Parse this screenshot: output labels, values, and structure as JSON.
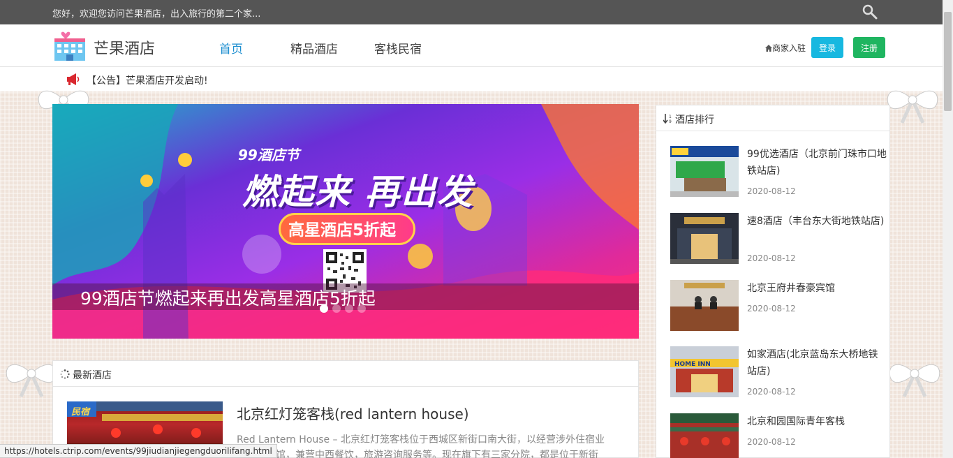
{
  "topbar": {
    "welcome": "您好，欢迎您访问芒果酒店，出入旅行的第二个家..."
  },
  "header": {
    "logo_text": "芒果酒店",
    "nav": [
      "首页",
      "精品酒店",
      "客栈民宿"
    ],
    "merchant": "商家入驻",
    "login": "登录",
    "register": "注册"
  },
  "notice": {
    "text": "【公告】芒果酒店开发启动!"
  },
  "banner": {
    "caption": "99酒店节燃起来再出发高星酒店5折起",
    "slogan_small": "99酒店节",
    "slogan_big": "燃起来 再出发",
    "pill": "高星酒店5折起",
    "active_slide": 1,
    "slide_count": 4
  },
  "ranking": {
    "title": "酒店排行",
    "items": [
      {
        "name": "99优选酒店（北京前门珠市口地铁站店)",
        "date": "2020-08-12"
      },
      {
        "name": "速8酒店（丰台东大街地铁站店)",
        "date": "2020-08-12"
      },
      {
        "name": "北京王府井春豪宾馆",
        "date": "2020-08-12"
      },
      {
        "name": "如家酒店(北京蓝岛东大桥地铁站店)",
        "date": "2020-08-12"
      },
      {
        "name": "北京和园国际青年客栈",
        "date": "2020-08-12"
      }
    ]
  },
  "latest": {
    "title": "最新酒店",
    "hotel_name": "北京红灯笼客栈(red lantern house)",
    "badge": "民宿",
    "desc": "Red Lantern House – 北京红灯笼客栈位于西城区新街口南大街，以经营涉外住宿业为特色旅馆，兼营中西餐饮，旅游咨询服务等。现在旗下有三家分院，都是位于新街"
  },
  "status_url": "https://hotels.ctrip.com/events/99jiudianjiegengduorilifang.html",
  "colors": {
    "accent_blue": "#1e8fd0",
    "login": "#17b8e0",
    "register": "#1fb560",
    "topbar": "#555555"
  }
}
